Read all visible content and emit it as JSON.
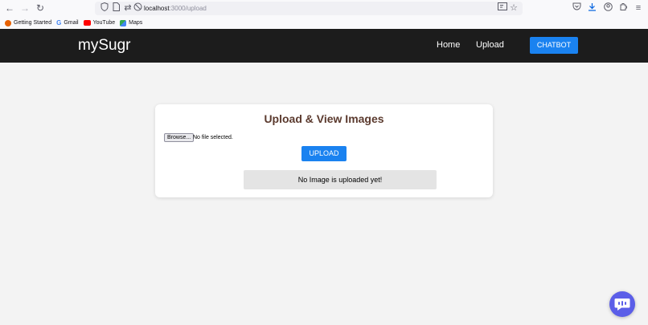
{
  "browser": {
    "url_host": "localhost",
    "url_path": ":3000/upload",
    "icons": {
      "back": "back-arrow-icon",
      "forward": "forward-arrow-icon",
      "reload": "reload-icon"
    }
  },
  "bookmarks": [
    {
      "label": "Getting Started",
      "icon": "firefox-icon",
      "color": "#e66000"
    },
    {
      "label": "Gmail",
      "icon": "google-icon",
      "color": "#4285f4"
    },
    {
      "label": "YouTube",
      "icon": "youtube-icon",
      "color": "#ff0000"
    },
    {
      "label": "Maps",
      "icon": "maps-icon",
      "color": "#34a853"
    }
  ],
  "navbar": {
    "brand": "mySugr",
    "links": [
      "Home",
      "Upload"
    ],
    "chatbot_label": "CHATBOT"
  },
  "card": {
    "title": "Upload & View Images",
    "browse_label": "Browse...",
    "file_status": "No file selected.",
    "upload_label": "UPLOAD",
    "empty_message": "No Image is uploaded yet!"
  },
  "colors": {
    "accent": "#1a82f0",
    "title": "#5b3a2e",
    "navbar_bg": "#1c1c1c",
    "fab": "#5b5ee8"
  }
}
